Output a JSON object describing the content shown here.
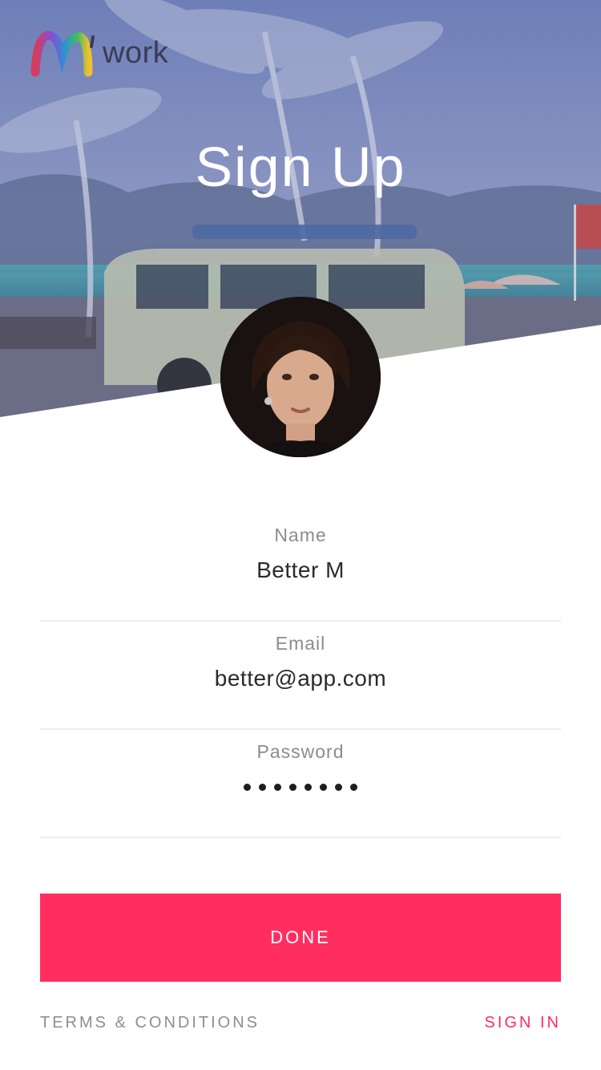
{
  "header": {
    "logo_text": "work",
    "title": "Sign Up"
  },
  "form": {
    "name": {
      "label": "Name",
      "value": "Better M"
    },
    "email": {
      "label": "Email",
      "value": "better@app.com"
    },
    "password": {
      "label": "Password",
      "value": "••••••••",
      "mask_count": 8
    }
  },
  "actions": {
    "done_label": "DONE",
    "terms_label": "TERMS & CONDITIONS",
    "signin_label": "SIGN IN"
  },
  "colors": {
    "accent": "#ff2e5f",
    "hero_overlay": "#7c86c4",
    "label_gray": "#8c8c8c"
  }
}
